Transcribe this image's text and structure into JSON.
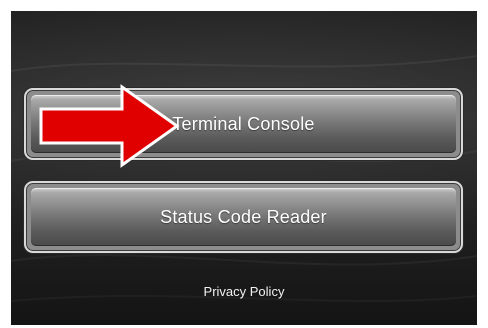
{
  "menu": {
    "terminal_console_label": "Terminal Console",
    "status_code_reader_label": "Status Code Reader",
    "privacy_policy_label": "Privacy Policy"
  },
  "annotation": {
    "arrow_color": "#e00000",
    "arrow_outline_color": "#ffffff",
    "icon": "red-arrow-right-icon"
  },
  "colors": {
    "background": "#1f1f1f",
    "button_border": "#d9d9d9",
    "button_text": "#ffffff"
  }
}
